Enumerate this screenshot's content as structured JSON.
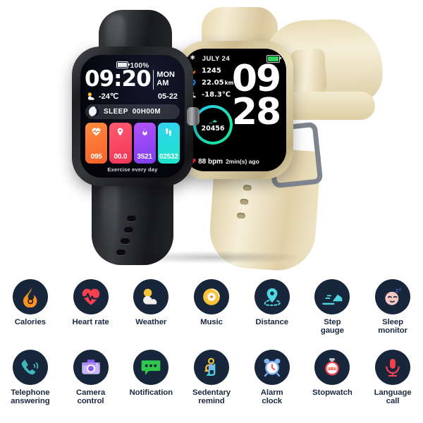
{
  "product": {
    "watch_black": {
      "name": "black-smartwatch",
      "screen": {
        "battery_percent": "100%",
        "battery_icon": "battery-full-icon",
        "time": "09:20",
        "day": "MON",
        "meridiem": "AM",
        "weather_icon": "sun-cloud-icon",
        "temperature": "-24℃",
        "date": "05-22",
        "sleep_icon": "moon-zz-icon",
        "sleep_label": "SLEEP",
        "sleep_value": "00H00M",
        "tiles": [
          {
            "icon": "heart-pulse-icon",
            "glyph": "♥",
            "value": "095",
            "color": "#f4622c",
            "name": "heart-rate-tile"
          },
          {
            "icon": "location-pin-icon",
            "glyph": "●",
            "value": "00.0",
            "color": "#f0365a",
            "name": "distance-tile"
          },
          {
            "icon": "flame-icon",
            "glyph": "▲",
            "value": "3521",
            "color": "#7b3df0",
            "name": "calories-tile"
          },
          {
            "icon": "footsteps-icon",
            "glyph": "❙❙",
            "value": "02532",
            "color": "#19e5c6",
            "name": "steps-tile"
          }
        ],
        "footer": "Exercise every day"
      }
    },
    "watch_beige": {
      "name": "beige-smartwatch",
      "screen": {
        "bluetooth_icon": "bluetooth-icon",
        "date": "JULY 24",
        "battery_icon": "battery-full-icon",
        "metrics": [
          {
            "icon": "flame-icon",
            "glyph": "🔥",
            "value": "1245",
            "unit": "",
            "name": "calories-metric"
          },
          {
            "icon": "location-pin-icon",
            "glyph": "📍",
            "value": "22.05",
            "unit": "km",
            "name": "distance-metric"
          },
          {
            "icon": "sun-cloud-icon",
            "glyph": "⛅",
            "value": "-18.3℃",
            "unit": "",
            "name": "temperature-metric"
          }
        ],
        "steps_ring": {
          "icon": "shoe-icon",
          "value": "20456"
        },
        "time_hours": "09",
        "time_minutes": "28",
        "heart_icon": "heart-icon",
        "heart_rate": "88 bpm",
        "heart_rate_ago": "2min(s) ago"
      }
    }
  },
  "features": {
    "row1": [
      {
        "label": "Calories",
        "icon": "flame-icon"
      },
      {
        "label": "Heart rate",
        "icon": "heart-pulse-icon"
      },
      {
        "label": "Weather",
        "icon": "sun-cloud-icon"
      },
      {
        "label": "Music",
        "icon": "vinyl-record-icon"
      },
      {
        "label": "Distance",
        "icon": "location-pin-icon"
      },
      {
        "label": "Step\ngauge",
        "icon": "shoe-icon"
      },
      {
        "label": "Sleep\nmonitor",
        "icon": "sleeping-face-icon"
      }
    ],
    "row2": [
      {
        "label": "Telephone\nanswering",
        "icon": "phone-ringing-icon"
      },
      {
        "label": "Camera\ncontrol",
        "icon": "camera-icon"
      },
      {
        "label": "Notification",
        "icon": "message-bubble-icon"
      },
      {
        "label": "Sedentary\nremind",
        "icon": "sitting-person-icon"
      },
      {
        "label": "Alarm\nclock",
        "icon": "alarm-clock-icon"
      },
      {
        "label": "Stopwatch",
        "icon": "stopwatch-icon"
      },
      {
        "label": "Language\ncall",
        "icon": "microphone-icon"
      }
    ]
  },
  "colors": {
    "icon_circle_bg": "#18263c",
    "label_text": "#1b2a40",
    "orange": "#f59324",
    "red": "#f8404f",
    "cyan": "#4fd6e0",
    "yellow": "#f6c43a",
    "green": "#2ec84b",
    "purple": "#8a5cf6",
    "blue": "#7fb4f0"
  }
}
